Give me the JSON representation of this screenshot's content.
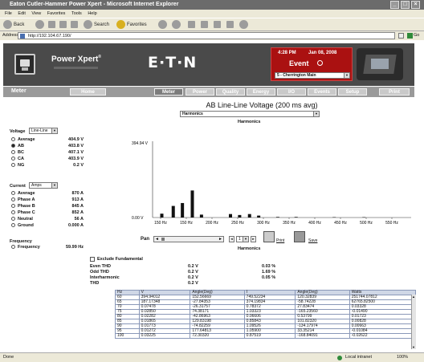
{
  "window": {
    "title": "Eaton Cutler-Hammer Power Xpert - Microsoft Internet Explorer"
  },
  "menu": [
    "File",
    "Edit",
    "View",
    "Favorites",
    "Tools",
    "Help"
  ],
  "toolbar": {
    "back": "Back",
    "search": "Search",
    "favorites": "Favorites"
  },
  "address": {
    "label": "Address",
    "url": "http://192.104.67.190/",
    "go": "Go"
  },
  "banner": {
    "product": "Power Xpert",
    "reg": "®",
    "brand": "E·T·N",
    "time": "4:28 PM",
    "date": "Jan 08, 2008",
    "event_label": "Event",
    "location": "5 - Cherrington Main"
  },
  "nav": {
    "page_title": "Meter",
    "items": [
      "Home",
      "Meter",
      "Power",
      "Quality",
      "Energy",
      "I/O",
      "Events",
      "Setup",
      "Print"
    ]
  },
  "view": {
    "title": "AB Line-Line Voltage (200 ms avg)",
    "select": "Harmonics",
    "subtitle": "Harmonics"
  },
  "voltage": {
    "label": "Voltage",
    "select": "Line-Line",
    "rows": [
      {
        "name": "Average",
        "value": "404.9 V",
        "selected": false
      },
      {
        "name": "AB",
        "value": "403.8 V",
        "selected": true
      },
      {
        "name": "BC",
        "value": "407.1 V",
        "selected": false
      },
      {
        "name": "CA",
        "value": "403.9 V",
        "selected": false
      },
      {
        "name": "NG",
        "value": "0.2 V",
        "selected": false
      }
    ]
  },
  "current": {
    "label": "Current",
    "select": "Amps",
    "rows": [
      {
        "name": "Average",
        "value": "870 A"
      },
      {
        "name": "Phase A",
        "value": "913 A"
      },
      {
        "name": "Phase B",
        "value": "845 A"
      },
      {
        "name": "Phase C",
        "value": "852 A"
      },
      {
        "name": "Neutral",
        "value": "56 A"
      },
      {
        "name": "Ground",
        "value": "0.000 A"
      }
    ]
  },
  "frequency": {
    "label": "Frequency",
    "row": "Frequency",
    "value": "59.99 Hz"
  },
  "chart_data": {
    "type": "bar",
    "ymax_label": "394.94 V",
    "ymin_label": "0.00 V",
    "xticks": [
      "150 Hz",
      "150 Hz",
      "200 Hz",
      "250 Hz",
      "300 Hz",
      "350 Hz",
      "400 Hz",
      "450 Hz",
      "500 Hz",
      "550 Hz"
    ],
    "bars": [
      {
        "x": 120,
        "v": 20
      },
      {
        "x": 135,
        "v": 60
      },
      {
        "x": 147,
        "v": 75
      },
      {
        "x": 160,
        "v": 140
      },
      {
        "x": 172,
        "v": 15
      },
      {
        "x": 210,
        "v": 18
      },
      {
        "x": 222,
        "v": 13
      },
      {
        "x": 235,
        "v": 18
      },
      {
        "x": 247,
        "v": 10
      },
      {
        "x": 272,
        "v": 3
      },
      {
        "x": 296,
        "v": 3
      },
      {
        "x": 346,
        "v": 2
      },
      {
        "x": 385,
        "v": 2
      }
    ],
    "vmax": 394.94
  },
  "pan": {
    "label": "Pan",
    "page": "1",
    "print": "Print",
    "save": "Save",
    "caption": "Harmonics",
    "exclude": "Exclude Fundamental"
  },
  "thd": [
    {
      "name": "Even THD",
      "v": "0.2 V",
      "p": "0.03 %"
    },
    {
      "name": "Odd THD",
      "v": "0.2 V",
      "p": "1.69 %"
    },
    {
      "name": "Interharmonic",
      "v": "0.2 V",
      "p": "0.05 %"
    },
    {
      "name": "THD",
      "v": "0.2 V",
      "p": ""
    }
  ],
  "table": {
    "headers": [
      "Hz",
      "V",
      "Angle(Deg)",
      "I",
      "Angle(Deg)",
      "Watts"
    ],
    "rows": [
      [
        "60",
        "394.94012",
        "152.56669",
        "749.52234",
        "120.32839",
        "251744.07812"
      ],
      [
        "65",
        "187.17348",
        "-27.84353",
        "374.19834",
        "-58.74228",
        "62765.82500"
      ],
      [
        "70",
        "0.07478",
        "-26.31757",
        "0.78372",
        "27.83474",
        "0.03328"
      ],
      [
        "75",
        "0.02850",
        "74.38171",
        "1.03323",
        "-165.23560",
        "-0.01490"
      ],
      [
        "80",
        "0.02282",
        "-42.86963",
        "0.06606",
        "0.53799",
        "0.01723"
      ],
      [
        "85",
        "0.01865",
        "129.83198",
        "0.85843",
        "101.82320",
        "0.00828"
      ],
      [
        "90",
        "0.01773",
        "-74.82259",
        "1.09526",
        "-134.17974",
        "0.00663"
      ],
      [
        "95",
        "0.01272",
        "177.64813",
        "1.05900",
        "33.35214",
        "-0.01084"
      ],
      [
        "100",
        "0.03225",
        "72.30320",
        "0.87519",
        "-168.84091",
        "-0.02622"
      ]
    ]
  },
  "status": {
    "left": "Done",
    "zone": "Local intranet",
    "zoom": "100%"
  }
}
